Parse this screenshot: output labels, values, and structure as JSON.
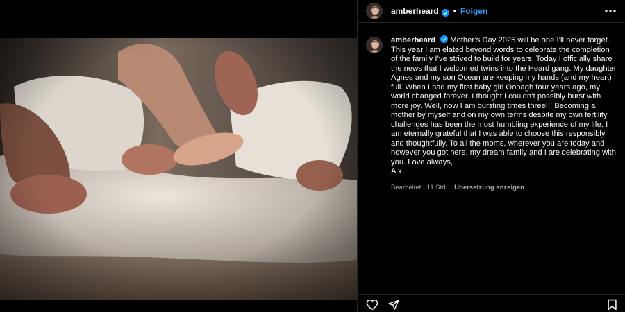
{
  "post": {
    "username": "amberheard",
    "follow_label": "Folgen",
    "separator": "•"
  },
  "caption": {
    "username": "amberheard",
    "text": "Mother’s Day 2025 will be one I’ll never forget. This year I am elated beyond words to celebrate the completion of the family I’ve strived to build for years. Today I officially share the news that I welcomed twins into the Heard gang. My daughter Agnes and my son Ocean are keeping my hands (and my heart) full. When I had my first baby girl Oonagh four years ago, my world changed forever. I thought I couldn’t possibly burst with more joy. Well, now I am bursting times three!!! Becoming a mother by myself and on my own terms despite my own fertility challenges has been the most humbling experience of my life. I am eternally grateful that I was able to choose this responsibly and thoughtfully. To all the moms, wherever you are today and however you got here, my dream family and I are celebrating with you. Love always,",
    "signoff": "A x"
  },
  "meta": {
    "edited": "Bearbeitet · 11 Std.",
    "translate": "Übersetzung anzeigen"
  },
  "icons": {
    "verified": "verified-badge-icon",
    "more": "more-options-icon",
    "like": "heart-icon",
    "share": "share-icon",
    "save": "bookmark-icon"
  },
  "colors": {
    "accent": "#3897f0",
    "verified": "#0095f6",
    "background": "#000000",
    "muted": "#a8a8a8"
  }
}
